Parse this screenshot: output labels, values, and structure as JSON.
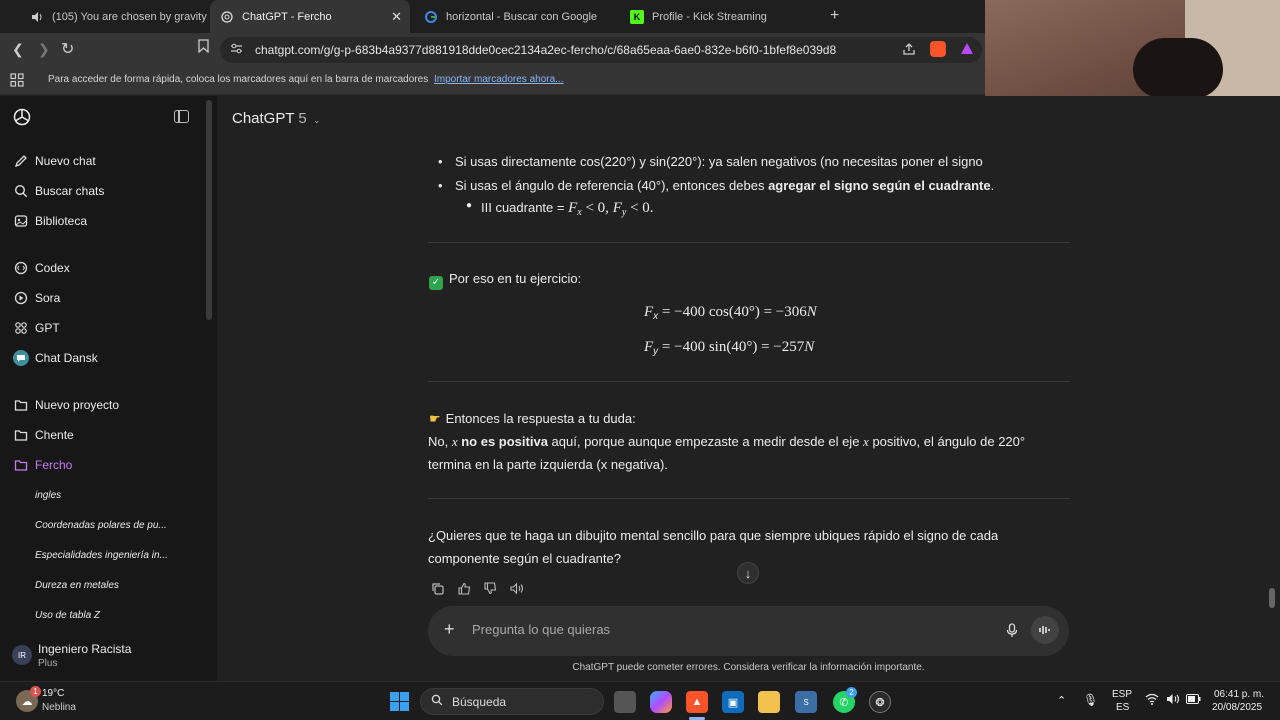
{
  "browser": {
    "tabs": [
      {
        "title": "(105) You are chosen by gravity",
        "icon": "speaker-icon",
        "active": false
      },
      {
        "title": "ChatGPT - Fercho",
        "icon": "chatgpt-icon",
        "active": true
      },
      {
        "title": "horizontal - Buscar con Google",
        "icon": "google-icon",
        "active": false
      },
      {
        "title": "Profile - Kick Streaming",
        "icon": "kick-icon",
        "active": false
      }
    ],
    "url": "chatgpt.com/g/g-p-683b4a9377d881918dde0cec2134a2ec-fercho/c/68a65eaa-6ae0-832e-b6f0-1bfef8e039d8",
    "bookmarks_text": "Para acceder de forma rápida, coloca los marcadores aquí en la barra de marcadores",
    "bookmarks_link": "Importar marcadores ahora..."
  },
  "sidebar": {
    "top_items": [
      {
        "label": "Nuevo chat",
        "icon": "new-chat-icon"
      },
      {
        "label": "Buscar chats",
        "icon": "search-icon"
      },
      {
        "label": "Biblioteca",
        "icon": "library-icon"
      }
    ],
    "gpt_items": [
      {
        "label": "Codex",
        "icon": "codex-icon"
      },
      {
        "label": "Sora",
        "icon": "sora-icon"
      },
      {
        "label": "GPT",
        "icon": "gpt-grid-icon"
      },
      {
        "label": "Chat Dansk",
        "icon": "chat-dansk-icon"
      }
    ],
    "project_items": [
      {
        "label": "Nuevo proyecto",
        "icon": "folder-plus-icon"
      },
      {
        "label": "Chente",
        "icon": "folder-icon"
      },
      {
        "label": "Fercho",
        "icon": "folder-icon",
        "accent": true
      }
    ],
    "chats": [
      "ingles",
      "Coordenadas polares de pu...",
      "Especialidades ingeniería in...",
      "Dureza en metales",
      "Uso de tabla Z"
    ],
    "user": {
      "initials": "IR",
      "name": "Ingeniero Racista",
      "plan": "Plus"
    }
  },
  "header": {
    "model_name": "ChatGPT",
    "model_version": "5"
  },
  "message": {
    "bullet1": "Si usas directamente cos(220°) y sin(220°): ya salen negativos (no necesitas poner el signo",
    "bullet2_pre": "Si usas el ángulo de referencia (40°), entonces debes ",
    "bullet2_bold": "agregar el signo según el cuadrante",
    "bullet2_post": ".",
    "sub_bullet_pre": "III cuadrante = ",
    "section1": "Por eso en tu ejercicio:",
    "eq1_var": "F",
    "eq1_sub": "x",
    "eq1_rhs": " = −400 cos(40°) = −306",
    "eq1_unit": "N",
    "eq2_var": "F",
    "eq2_sub": "y",
    "eq2_rhs": " = −400 sin(40°) = −257",
    "eq2_unit": "N",
    "section2": "Entonces la respuesta a tu duda:",
    "answer_pre": "No, ",
    "answer_var": "x",
    "answer_bold": " no es positiva",
    "answer_mid": " aquí, porque aunque empezaste a medir desde el eje ",
    "answer_var2": "x",
    "answer_post": " positivo, el ángulo de 220°",
    "answer_line2": "termina en la parte izquierda (x negativa).",
    "followup_line1": "¿Quieres que te haga un dibujito mental sencillo para que siempre ubiques rápido el signo de cada",
    "followup_line2": "componente según el cuadrante?"
  },
  "composer": {
    "placeholder": "Pregunta lo que quieras"
  },
  "disclaimer": "ChatGPT puede cometer errores. Considera verificar la información importante.",
  "taskbar": {
    "temp": "19°C",
    "condition": "Neblina",
    "search_label": "Búsqueda",
    "lang1": "ESP",
    "lang2": "ES",
    "time": "06:41 p. m.",
    "date": "20/08/2025",
    "weather_badge": "1",
    "whatsapp_badge": "2"
  }
}
